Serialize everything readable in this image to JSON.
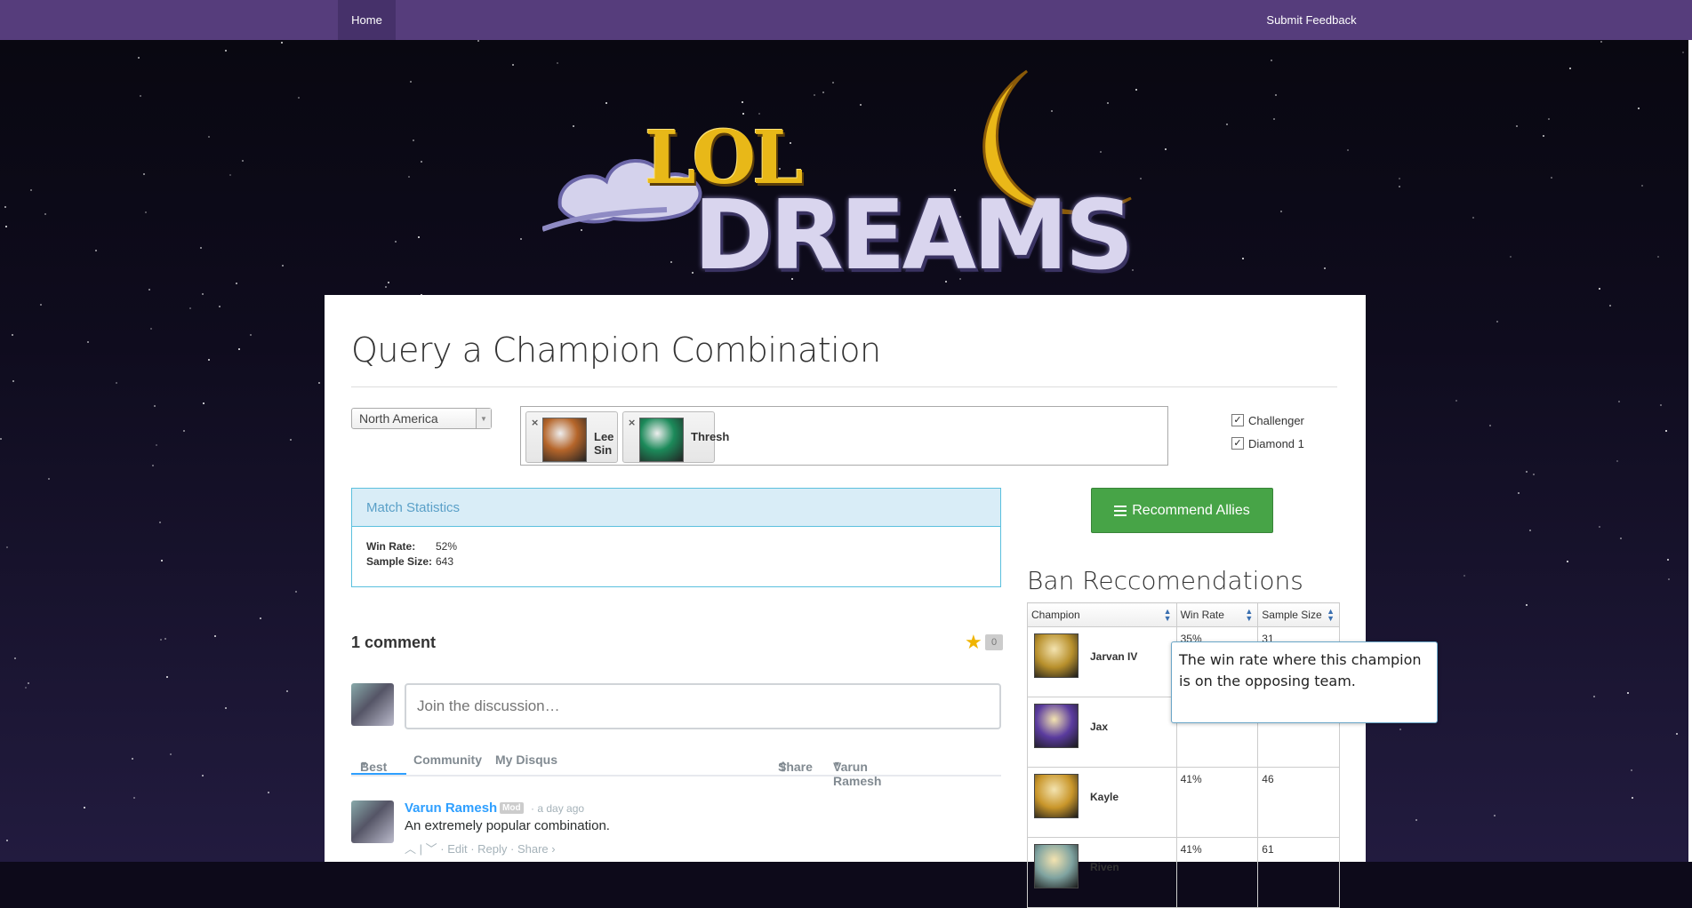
{
  "nav": {
    "home": "Home",
    "feedback": "Submit Feedback"
  },
  "logo": {
    "line1": "LOL",
    "line2": "DREAMS"
  },
  "page": {
    "title": "Query a Champion Combination"
  },
  "query": {
    "region": "North America",
    "champions": [
      {
        "name": "Lee Sin",
        "color": "#b5652a"
      },
      {
        "name": "Thresh",
        "color": "#1c8a5a"
      }
    ],
    "tiers": [
      {
        "label": "Challenger",
        "checked": true
      },
      {
        "label": "Diamond 1",
        "checked": true
      }
    ]
  },
  "stats": {
    "heading": "Match Statistics",
    "win_rate_label": "Win Rate:",
    "win_rate": "52%",
    "sample_size_label": "Sample Size:",
    "sample_size": "643"
  },
  "recommend_button": "Recommend Allies",
  "ban": {
    "title": "Ban Reccomendations",
    "columns": [
      "Champion",
      "Win Rate",
      "Sample Size"
    ],
    "rows": [
      {
        "champion": "Jarvan IV",
        "win_rate": "35%",
        "sample_size": "31",
        "color": "#b8902c"
      },
      {
        "champion": "Jax",
        "win_rate": "",
        "sample_size": "",
        "color": "#5a3b9e"
      },
      {
        "champion": "Kayle",
        "win_rate": "41%",
        "sample_size": "46",
        "color": "#c9962a"
      },
      {
        "champion": "Riven",
        "win_rate": "41%",
        "sample_size": "61",
        "color": "#7fa3a0"
      }
    ],
    "tooltip": "The win rate where this champion is on the opposing team."
  },
  "comments": {
    "count_label": "1 comment",
    "recommend_count": "0",
    "placeholder": "Join the discussion…",
    "tabs": {
      "best": "Best",
      "community": "Community",
      "my_disqus": "My Disqus",
      "share": "Share",
      "user": "Varun Ramesh"
    },
    "items": [
      {
        "author": "Varun Ramesh",
        "badge": "Mod",
        "time": "a day ago",
        "text": "An extremely popular combination.",
        "actions": "Edit · Reply · Share ›"
      }
    ]
  }
}
